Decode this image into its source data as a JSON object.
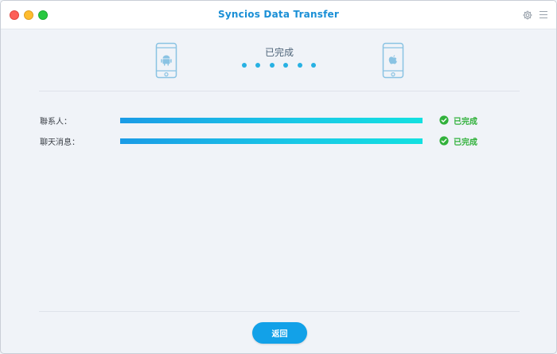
{
  "window": {
    "title": "Syncios Data Transfer",
    "title_color": "#1a8fd6"
  },
  "icons": {
    "settings": "gear-icon",
    "menu": "hamburger-menu-icon",
    "source_device": "android-phone-icon",
    "target_device": "apple-phone-icon",
    "row_status": "check-circle-icon"
  },
  "transfer": {
    "status": "已完成",
    "progress_dots": 6,
    "rows": [
      {
        "label": "聯系人：",
        "progress": 1.0,
        "status": "已完成"
      },
      {
        "label": "聊天消息：",
        "progress": 1.0,
        "status": "已完成"
      }
    ]
  },
  "footer": {
    "back_label": "返回"
  },
  "colors": {
    "accent": "#12a1e8",
    "success": "#31b13b",
    "progress_start": "#1a9be6",
    "progress_end": "#13e0e0"
  }
}
